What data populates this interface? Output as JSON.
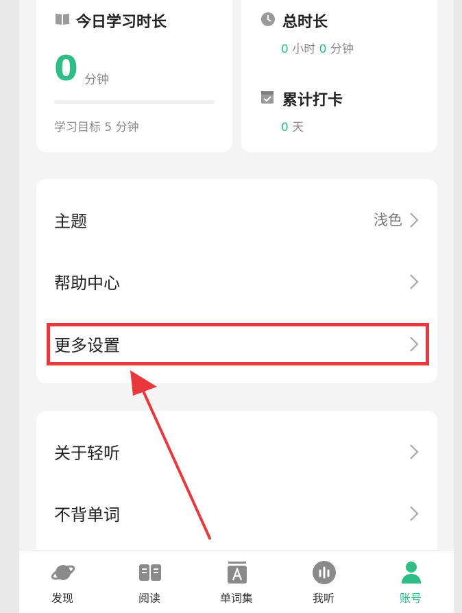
{
  "today_card": {
    "title": "今日学习时长",
    "value": "0",
    "unit": "分钟",
    "goal": "学习目标 5 分钟",
    "progress": 0
  },
  "total_card": {
    "title": "总时长",
    "hours": "0",
    "hours_unit": "小时",
    "minutes": "0",
    "minutes_unit": "分钟",
    "checkin_title": "累计打卡",
    "checkin_days": "0",
    "checkin_unit": "天"
  },
  "settings_group_1": [
    {
      "label": "主题",
      "value": "浅色"
    },
    {
      "label": "帮助中心",
      "value": ""
    },
    {
      "label": "更多设置",
      "value": ""
    }
  ],
  "settings_group_2": [
    {
      "label": "关于轻听"
    },
    {
      "label": "不背单词"
    }
  ],
  "tabs": [
    {
      "label": "发现",
      "icon": "planet-icon"
    },
    {
      "label": "阅读",
      "icon": "book-open-icon"
    },
    {
      "label": "单词集",
      "icon": "vocabulary-icon"
    },
    {
      "label": "我听",
      "icon": "audio-bars-icon"
    },
    {
      "label": "账号",
      "icon": "user-icon",
      "active": true
    }
  ],
  "colors": {
    "accent": "#2ebd85",
    "highlight_box": "#e8383d",
    "annotation_arrow": "#e8383d"
  }
}
